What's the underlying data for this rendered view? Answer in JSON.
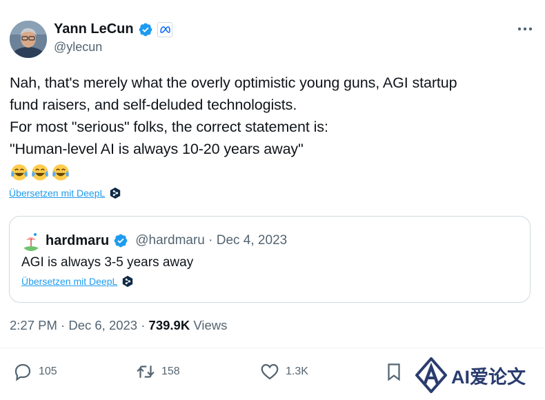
{
  "author": {
    "display_name": "Yann LeCun",
    "handle": "@ylecun",
    "affiliation": "meta"
  },
  "tweet": {
    "lines": [
      "Nah, that's merely what the overly optimistic young guns, AGI startup",
      "fund raisers, and self-deluded technologists.",
      "For most \"serious\" folks, the correct statement is:",
      "\"Human-level AI is always 10-20 years away\""
    ],
    "emojis": [
      "face-with-tears-of-joy",
      "face-with-tears-of-joy",
      "face-with-tears-of-joy"
    ],
    "translate_label": "Übersetzen mit DeepL"
  },
  "quote": {
    "display_name": "hardmaru",
    "handle_date": "@hardmaru · Dec 4, 2023",
    "text": "AGI is always 3-5 years away",
    "translate_label": "Übersetzen mit DeepL"
  },
  "meta": {
    "time_date": "2:27 PM · Dec 6, 2023 · ",
    "views_count": "739.9K",
    "views_label": " Views"
  },
  "actions": {
    "replies": "105",
    "reposts": "158",
    "likes": "1.3K"
  },
  "watermark": {
    "text": "AI爱论文"
  },
  "colors": {
    "accent": "#1d9bf0",
    "text": "#0f1419",
    "muted": "#536471",
    "border": "#cfd9de"
  }
}
